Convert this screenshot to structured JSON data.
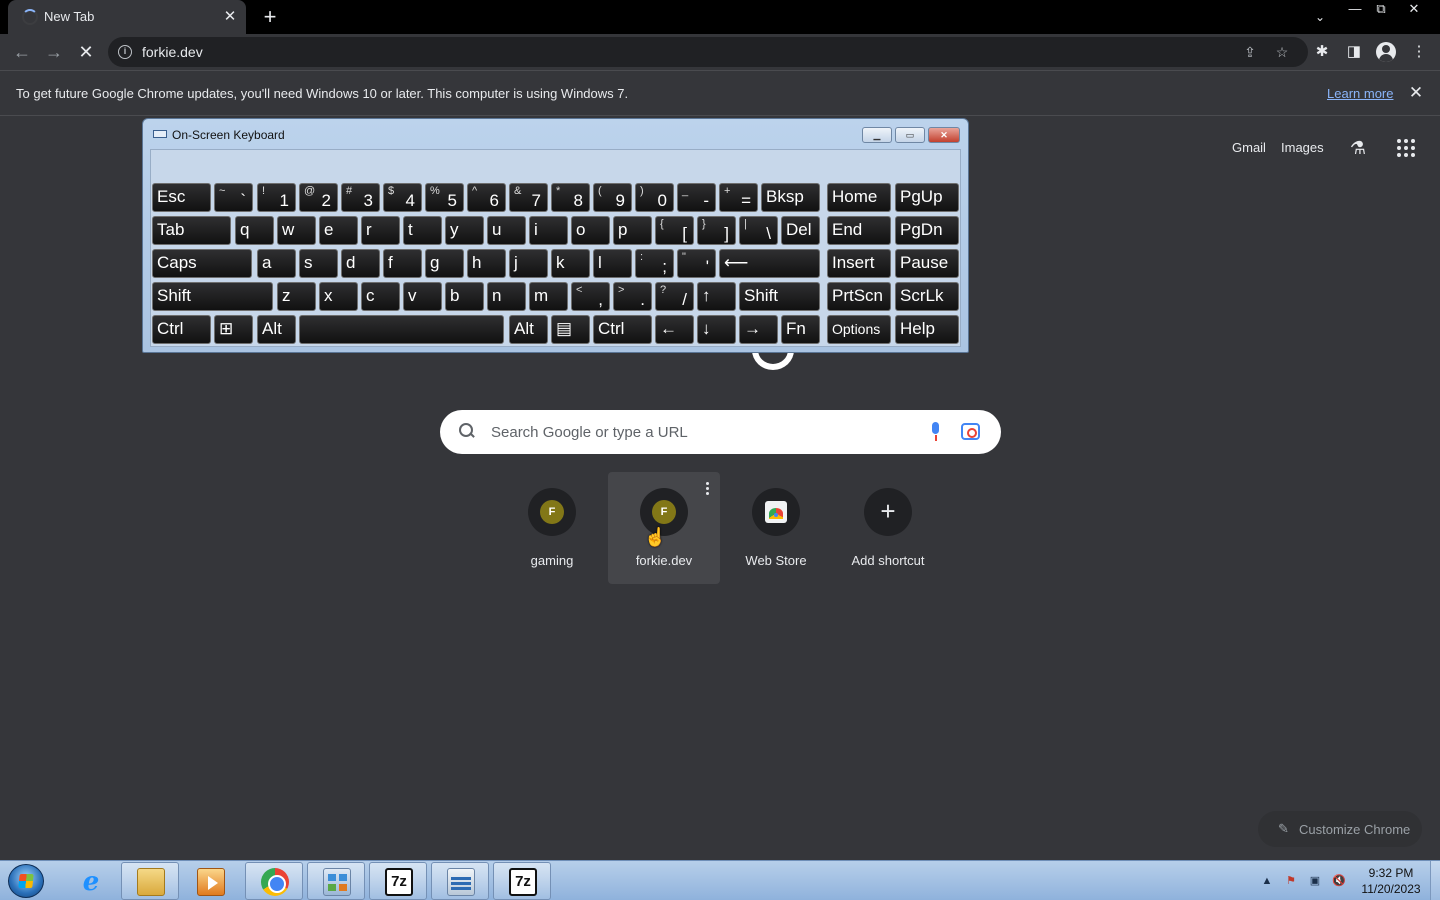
{
  "browser": {
    "tab_title": "New Tab",
    "tab_close": "✕",
    "new_tab": "+",
    "tab_search": "⌄",
    "window_controls": [
      "—",
      "⧉",
      "✕"
    ],
    "url": "forkie.dev",
    "back": "←",
    "forward": "→",
    "stop": "✕",
    "toolbar_icons": [
      "share-icon",
      "bookmark-star-icon",
      "extensions-icon",
      "side-panel-icon",
      "profile-icon",
      "menu-icon"
    ]
  },
  "infobar": {
    "message": "To get future Google Chrome updates, you'll need Windows 10 or later. This computer is using Windows 7.",
    "link": "Learn more",
    "close": "✕"
  },
  "ntp": {
    "links": [
      "Gmail",
      "Images"
    ],
    "search_placeholder": "Search Google or type a URL",
    "shortcuts": [
      {
        "label": "gaming",
        "letter": "F"
      },
      {
        "label": "forkie.dev",
        "letter": "F"
      },
      {
        "label": "Web Store"
      },
      {
        "label": "Add shortcut",
        "glyph": "+"
      }
    ],
    "customize": "Customize Chrome"
  },
  "osk": {
    "title": "On-Screen Keyboard",
    "rows": [
      [
        {
          "m": "Esc"
        },
        {
          "t": "~",
          "b": "`"
        },
        {
          "t": "!",
          "b": "1"
        },
        {
          "t": "@",
          "b": "2"
        },
        {
          "t": "#",
          "b": "3"
        },
        {
          "t": "$",
          "b": "4"
        },
        {
          "t": "%",
          "b": "5"
        },
        {
          "t": "^",
          "b": "6"
        },
        {
          "t": "&",
          "b": "7"
        },
        {
          "t": "*",
          "b": "8"
        },
        {
          "t": "(",
          "b": "9"
        },
        {
          "t": ")",
          "b": "0"
        },
        {
          "t": "_",
          "b": "-"
        },
        {
          "t": "+",
          "b": "="
        },
        {
          "m": "Bksp"
        },
        {
          "m": "Home"
        },
        {
          "m": "PgUp"
        }
      ],
      [
        {
          "m": "Tab"
        },
        {
          "m": "q"
        },
        {
          "m": "w"
        },
        {
          "m": "e"
        },
        {
          "m": "r"
        },
        {
          "m": "t"
        },
        {
          "m": "y"
        },
        {
          "m": "u"
        },
        {
          "m": "i"
        },
        {
          "m": "o"
        },
        {
          "m": "p"
        },
        {
          "t": "{",
          "b": "["
        },
        {
          "t": "}",
          "b": "]"
        },
        {
          "t": "|",
          "b": "\\"
        },
        {
          "m": "Del"
        },
        {
          "m": "End"
        },
        {
          "m": "PgDn"
        }
      ],
      [
        {
          "m": "Caps"
        },
        {
          "m": "a"
        },
        {
          "m": "s"
        },
        {
          "m": "d"
        },
        {
          "m": "f"
        },
        {
          "m": "g"
        },
        {
          "m": "h"
        },
        {
          "m": "j"
        },
        {
          "m": "k"
        },
        {
          "m": "l"
        },
        {
          "t": ":",
          "b": ";"
        },
        {
          "t": "\"",
          "b": "'"
        },
        {
          "m": "⟵"
        },
        {
          "m": "Insert"
        },
        {
          "m": "Pause"
        }
      ],
      [
        {
          "m": "Shift"
        },
        {
          "m": "z"
        },
        {
          "m": "x"
        },
        {
          "m": "c"
        },
        {
          "m": "v"
        },
        {
          "m": "b"
        },
        {
          "m": "n"
        },
        {
          "m": "m"
        },
        {
          "t": "<",
          "b": ","
        },
        {
          "t": ">",
          "b": "."
        },
        {
          "t": "?",
          "b": "/"
        },
        {
          "m": "↑"
        },
        {
          "m": "Shift"
        },
        {
          "m": "PrtScn"
        },
        {
          "m": "ScrLk"
        }
      ],
      [
        {
          "m": "Ctrl"
        },
        {
          "m": "⊞"
        },
        {
          "m": "Alt"
        },
        {
          "m": ""
        },
        {
          "m": "Alt"
        },
        {
          "m": "▤"
        },
        {
          "m": "Ctrl"
        },
        {
          "m": "←"
        },
        {
          "m": "↓"
        },
        {
          "m": "→"
        },
        {
          "m": "Fn"
        },
        {
          "m": "Options",
          "small": true
        },
        {
          "m": "Help"
        }
      ]
    ]
  },
  "taskbar": {
    "apps": [
      "internet-explorer-icon",
      "windows-explorer-icon",
      "media-player-icon",
      "chrome-icon",
      "control-panel-icon",
      "7zip-icon",
      "network-icon",
      "7zip-icon"
    ],
    "seven_zip_label": "7z",
    "clock_time": "9:32 PM",
    "clock_date": "11/20/2023",
    "tray_arrow": "▲"
  }
}
